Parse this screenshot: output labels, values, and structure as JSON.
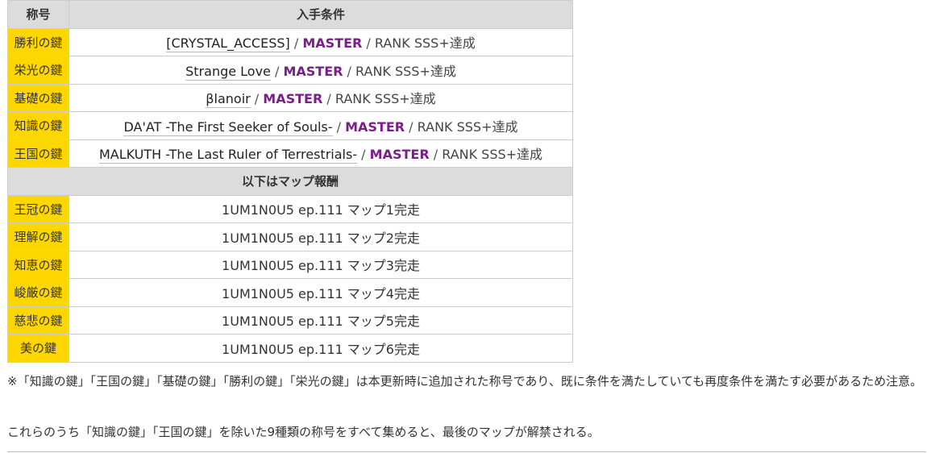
{
  "table": {
    "header": {
      "col1": "称号",
      "col2": "入手条件"
    },
    "rows": [
      {
        "name": "勝利の鍵",
        "song": "[CRYSTAL_ACCESS]",
        "sep1": " / ",
        "difficulty": "MASTER",
        "sep2": " / ",
        "rank": "RANK SSS+達成"
      },
      {
        "name": "栄光の鍵",
        "song": "Strange Love",
        "sep1": " / ",
        "difficulty": "MASTER",
        "sep2": " / ",
        "rank": "RANK SSS+達成"
      },
      {
        "name": "基礎の鍵",
        "song": "βlanoir",
        "sep1": " / ",
        "difficulty": "MASTER",
        "sep2": " / ",
        "rank": "RANK SSS+達成"
      },
      {
        "name": "知識の鍵",
        "song": "DA'AT -The First Seeker of Souls-",
        "sep1": " / ",
        "difficulty": "MASTER",
        "sep2": " / ",
        "rank": "RANK SSS+達成"
      },
      {
        "name": "王国の鍵",
        "song": "MALKUTH -The Last Ruler of Terrestrials-",
        "sep1": " / ",
        "difficulty": "MASTER",
        "sep2": " / ",
        "rank": "RANK SSS+達成"
      }
    ],
    "section_header": "以下はマップ報酬",
    "map_rows": [
      {
        "name": "王冠の鍵",
        "condition": "1UM1N0U5 ep.111 マップ1完走"
      },
      {
        "name": "理解の鍵",
        "condition": "1UM1N0U5 ep.111 マップ2完走"
      },
      {
        "name": "知恵の鍵",
        "condition": "1UM1N0U5 ep.111 マップ3完走"
      },
      {
        "name": "峻厳の鍵",
        "condition": "1UM1N0U5 ep.111 マップ4完走"
      },
      {
        "name": "慈悲の鍵",
        "condition": "1UM1N0U5 ep.111 マップ5完走"
      },
      {
        "name": "美の鍵",
        "condition": "1UM1N0U5 ep.111 マップ6完走"
      }
    ]
  },
  "notes": {
    "note1": "※「知識の鍵」「王国の鍵」「基礎の鍵」「勝利の鍵」「栄光の鍵」は本更新時に追加された称号であり、既に条件を満たしていても再度条件を満たす必要があるため注意。",
    "note2": "これらのうち「知識の鍵」「王国の鍵」を除いた9種類の称号をすべて集めると、最後のマップが解禁される。"
  },
  "colors": {
    "name_cell_bg": "#ffd700",
    "header_bg": "#dcdcdc",
    "difficulty_text": "#7a1f8a"
  }
}
